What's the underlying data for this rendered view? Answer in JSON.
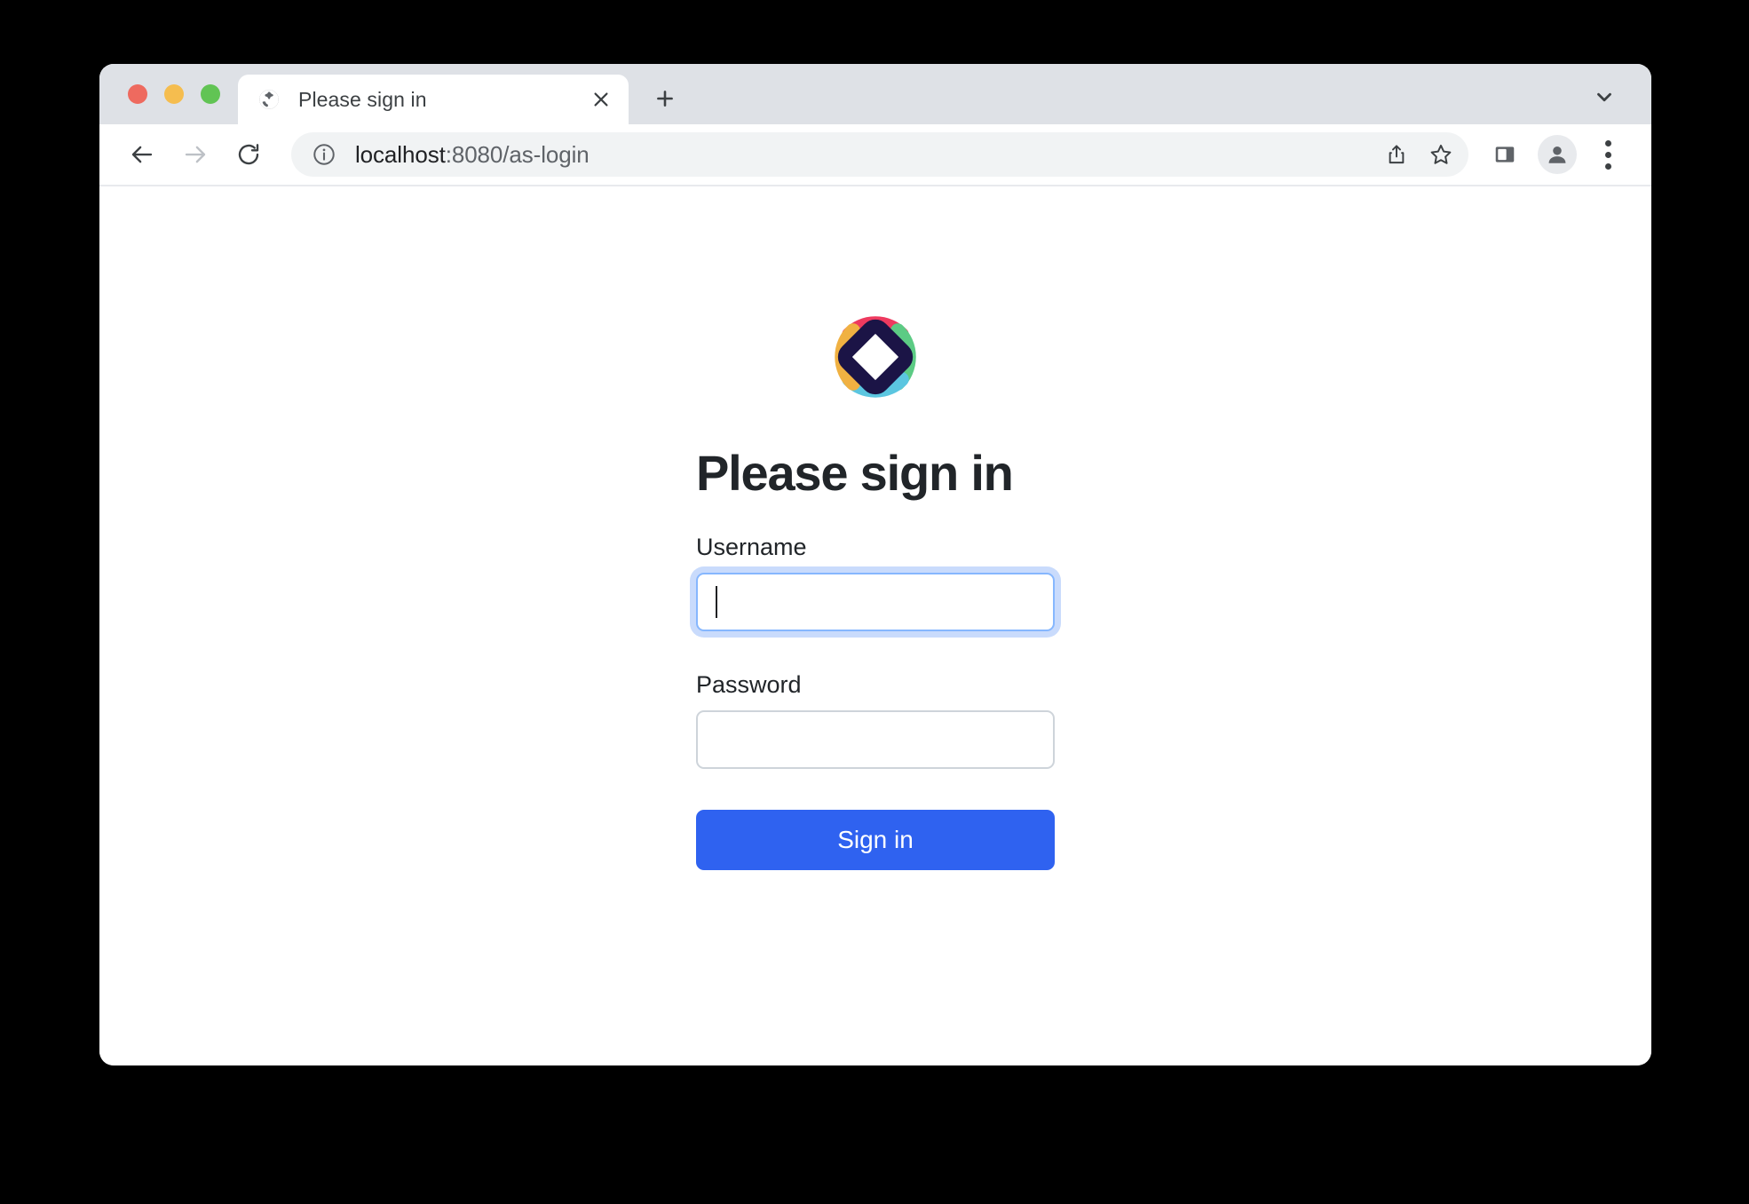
{
  "window": {
    "traffic_lights": [
      {
        "name": "close",
        "color": "#ee6a5f"
      },
      {
        "name": "minimize",
        "color": "#f5bd4f"
      },
      {
        "name": "zoom",
        "color": "#61c454"
      }
    ]
  },
  "tabstrip": {
    "tabs": [
      {
        "title": "Please sign in",
        "favicon": "globe-icon",
        "close_label": "✕",
        "active": true
      }
    ],
    "new_tab_label": "+",
    "tab_list_icon": "chevron-down-icon"
  },
  "toolbar": {
    "back_icon": "back-arrow-icon",
    "forward_icon": "forward-arrow-icon",
    "reload_icon": "reload-icon",
    "site_info_icon": "info-circle-icon",
    "url_host": "localhost",
    "url_rest": ":8080/as-login",
    "url_full": "localhost:8080/as-login",
    "share_icon": "share-icon",
    "bookmark_icon": "star-icon",
    "side_panel_icon": "side-panel-icon",
    "profile_icon": "profile-avatar-icon",
    "menu_icon": "three-dot-menu-icon"
  },
  "page": {
    "logo": {
      "name": "spring-security-logo",
      "colors": {
        "center": "#1b1446",
        "top": "#ee3a5f",
        "right": "#5ccb84",
        "bottom": "#5bc6e0",
        "left": "#f0b142"
      }
    },
    "title": "Please sign in",
    "fields": [
      {
        "label": "Username",
        "name": "username-input",
        "value": "",
        "placeholder": "",
        "focused": true,
        "type": "text"
      },
      {
        "label": "Password",
        "name": "password-input",
        "value": "",
        "placeholder": "",
        "focused": false,
        "type": "password"
      }
    ],
    "submit_label": "Sign in",
    "accent_color": "#2f62f0",
    "focus_ring_color": "#86b7fe"
  }
}
